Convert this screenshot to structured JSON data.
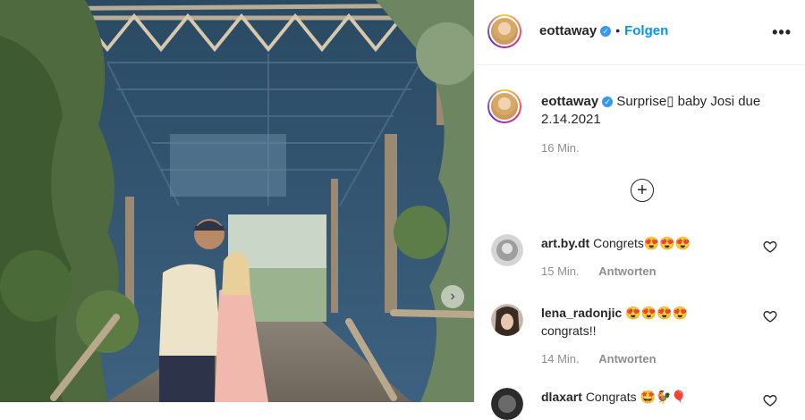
{
  "post": {
    "author": "eottaway",
    "follow_label": "Folgen",
    "separator": "•",
    "more_label": "•••",
    "caption": "Surprise▯ baby Josi due 2.14.2021",
    "time_ago": "16 Min.",
    "load_more_icon": "plus-circle-icon",
    "carousel_next_icon": "chevron-right-icon"
  },
  "comments": [
    {
      "user": "art.by.dt",
      "text": "Congrets",
      "emoji": "😍😍😍",
      "time": "15 Min.",
      "reply": "Antworten"
    },
    {
      "user": "lena_radonjic",
      "text": "",
      "emoji": "😍😍😍😍",
      "line2": "congrats!!",
      "time": "14 Min.",
      "reply": "Antworten"
    },
    {
      "user": "dlaxart",
      "text": "Congrats",
      "emoji": "🤩🐓🎈",
      "time": "",
      "reply": ""
    }
  ],
  "colors": {
    "accent": "#0095f6",
    "verified": "#3897f0",
    "muted": "#8e8e8e"
  }
}
